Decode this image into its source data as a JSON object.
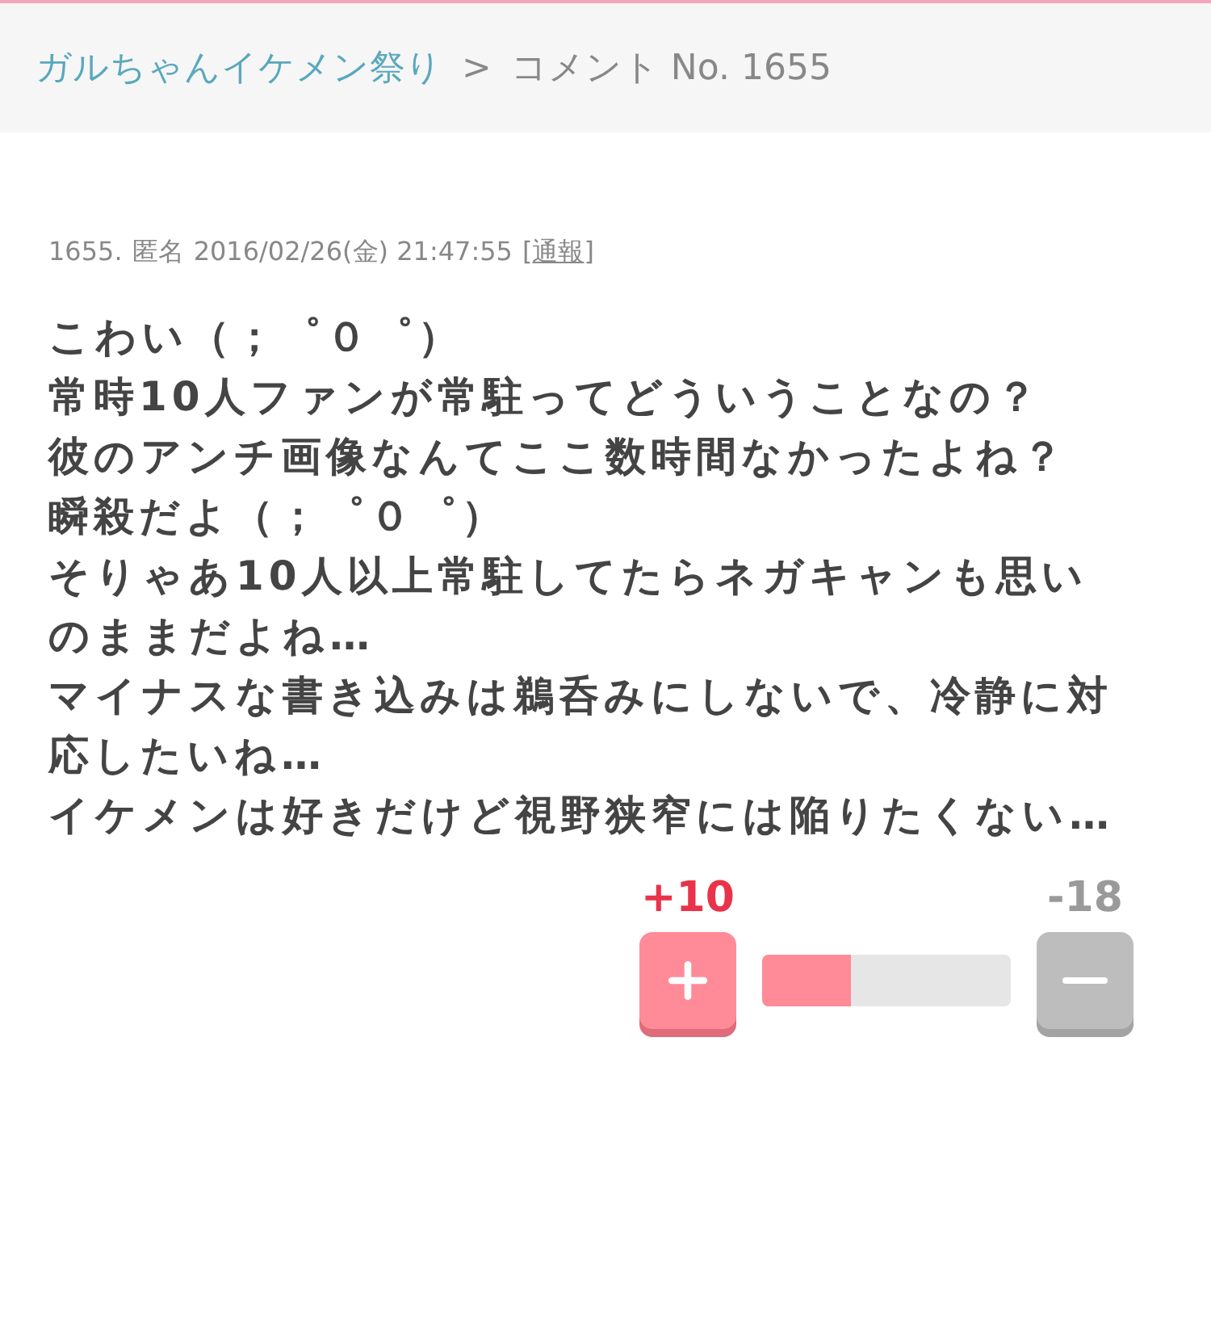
{
  "breadcrumb": {
    "link": "ガルちゃんイケメン祭り",
    "separator": ">",
    "current": "コメント No. 1655"
  },
  "comment": {
    "number": "1655.",
    "author": "匿名",
    "date": "2016/02/26(金) 21:47:55",
    "report_open": "[",
    "report": "通報",
    "report_close": "]",
    "lines": [
      "こわい（；゜０゜）",
      "常時10人ファンが常駐ってどういうことなの？",
      "彼のアンチ画像なんてここ数時間なかったよね？",
      "瞬殺だよ（；゜０゜）",
      "そりゃあ10人以上常駐してたらネガキャンも思い",
      "のままだよね…",
      "マイナスな書き込みは鵜呑みにしないで、冷静に対",
      "応したいね…",
      "イケメンは好きだけど視野狭窄には陥りたくない…"
    ]
  },
  "votes": {
    "plus": "+10",
    "minus": "-18",
    "level": 0.36
  }
}
